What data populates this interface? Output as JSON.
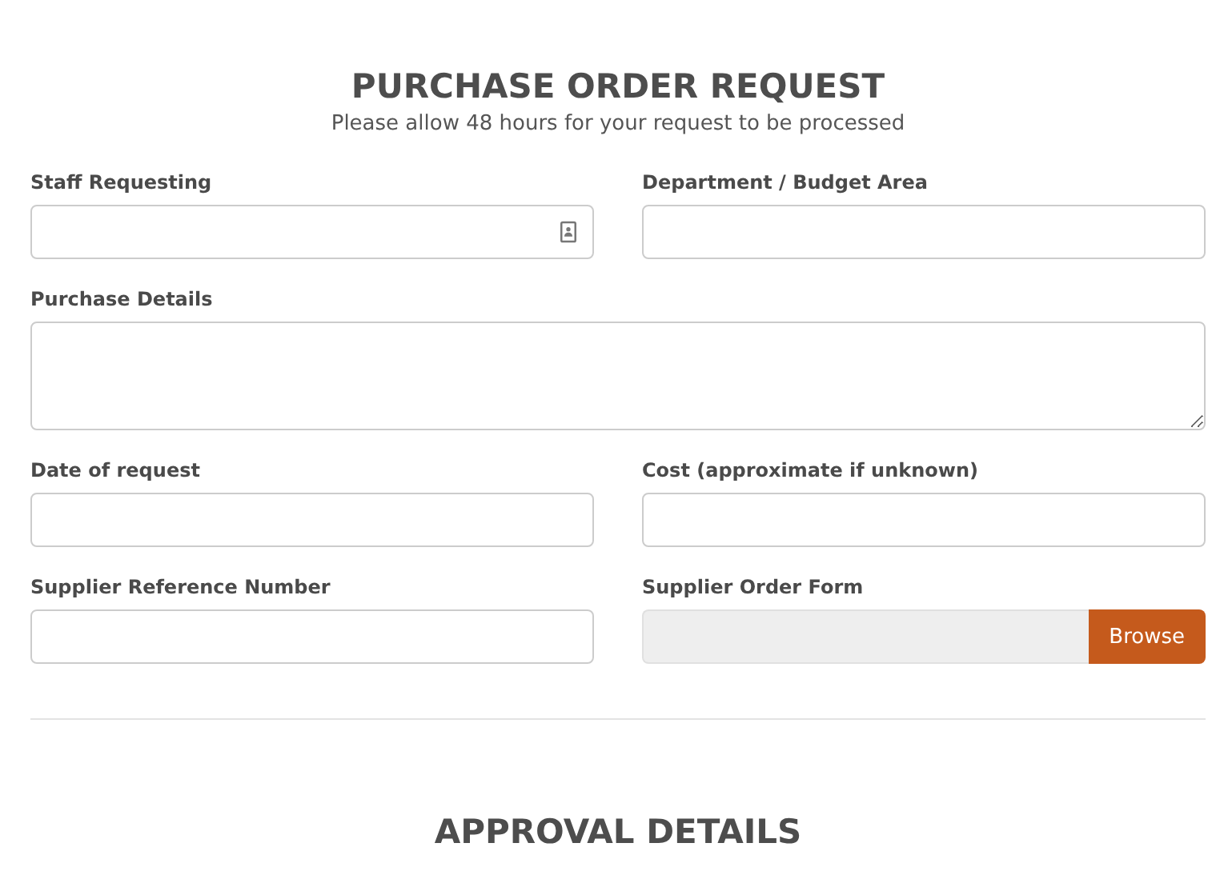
{
  "title": "PURCHASE ORDER REQUEST",
  "subtitle": "Please allow 48 hours for your request to be processed",
  "fields": [
    {
      "label": "Staff Requesting",
      "kind": "contact"
    },
    {
      "label": "Department / Budget Area",
      "kind": "text"
    },
    {
      "label": "Purchase Details",
      "kind": "textarea"
    },
    {
      "label": "Date of request",
      "kind": "text"
    },
    {
      "label": "Cost (approximate if unknown)",
      "kind": "text"
    },
    {
      "label": "Supplier Reference Number",
      "kind": "text"
    },
    {
      "label": "Supplier Order Form",
      "kind": "file",
      "button": "Browse"
    }
  ],
  "section_title": "APPROVAL DETAILS"
}
